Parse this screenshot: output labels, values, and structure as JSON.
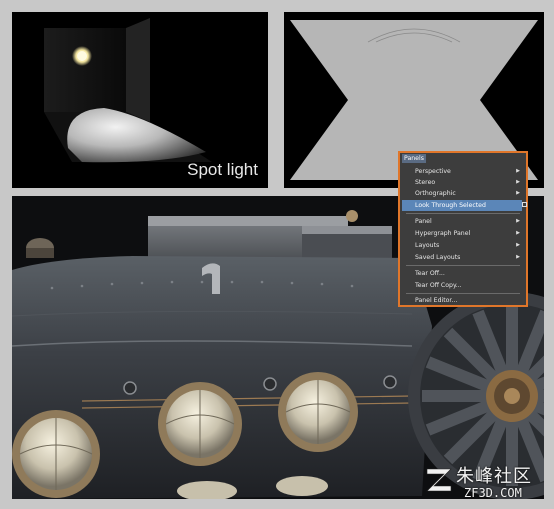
{
  "spot_view": {
    "caption": "Spot light"
  },
  "panels_menu": {
    "title": "Panels",
    "items": [
      {
        "label": "Perspective",
        "submenu": true
      },
      {
        "label": "Stereo",
        "submenu": true
      },
      {
        "label": "Orthographic",
        "submenu": true
      },
      {
        "label": "Look Through Selected",
        "highlighted": true,
        "option_box": true
      },
      {
        "label": "Panel",
        "submenu": true
      },
      {
        "label": "Hypergraph Panel",
        "submenu": true
      },
      {
        "label": "Layouts",
        "submenu": true
      },
      {
        "label": "Saved Layouts",
        "submenu": true
      },
      {
        "label": "Tear Off..."
      },
      {
        "label": "Tear Off Copy..."
      },
      {
        "label": "Panel Editor..."
      }
    ],
    "accent_color": "#e0762a",
    "highlight_color": "#5b86b8"
  },
  "watermark": {
    "text_cn": "朱峰社区",
    "url": "ZF3D.COM"
  }
}
